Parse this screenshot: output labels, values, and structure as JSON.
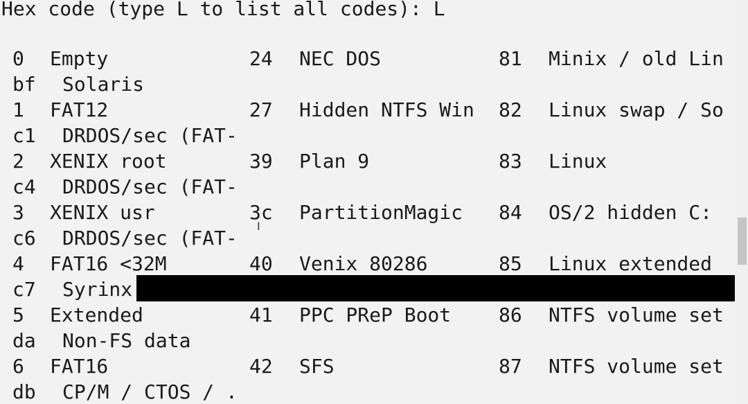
{
  "prompt": "Hex code (type L to list all codes): L",
  "rows": [
    {
      "type": "triple",
      "c1_code": "0",
      "c1_name": "Empty",
      "c2_code": "24",
      "c2_name": "NEC DOS",
      "c3_code": "81",
      "c3_name": "Minix / old Lin"
    },
    {
      "type": "single",
      "code": "bf",
      "name": "Solaris"
    },
    {
      "type": "triple",
      "c1_code": "1",
      "c1_name": "FAT12",
      "c2_code": "27",
      "c2_name": "Hidden NTFS Win",
      "c3_code": "82",
      "c3_name": "Linux swap / So"
    },
    {
      "type": "single",
      "code": "c1",
      "name": "DRDOS/sec (FAT-"
    },
    {
      "type": "triple",
      "c1_code": "2",
      "c1_name": "XENIX root",
      "c2_code": "39",
      "c2_name": "Plan 9",
      "c3_code": "83",
      "c3_name": "Linux"
    },
    {
      "type": "single",
      "code": "c4",
      "name": "DRDOS/sec (FAT-"
    },
    {
      "type": "triple",
      "c1_code": "3",
      "c1_name": "XENIX usr",
      "c2_code": "3c",
      "c2_name": "PartitionMagic",
      "c3_code": "84",
      "c3_name": "OS/2 hidden C:"
    },
    {
      "type": "single",
      "code": "c6",
      "name": "DRDOS/sec (FAT-"
    },
    {
      "type": "triple",
      "c1_code": "4",
      "c1_name": "FAT16 <32M",
      "c2_code": "40",
      "c2_name": "Venix 80286",
      "c3_code": "85",
      "c3_name": "Linux extended"
    },
    {
      "type": "single",
      "code": "c7",
      "name": "Syrinx"
    },
    {
      "type": "triple",
      "c1_code": "5",
      "c1_name": "Extended",
      "c2_code": "41",
      "c2_name": "PPC PReP Boot",
      "c3_code": "86",
      "c3_name": "NTFS volume set"
    },
    {
      "type": "single",
      "code": "da",
      "name": "Non-FS data"
    },
    {
      "type": "triple",
      "c1_code": "6",
      "c1_name": "FAT16",
      "c2_code": "42",
      "c2_name": "SFS",
      "c3_code": "87",
      "c3_name": "NTFS volume set"
    },
    {
      "type": "single",
      "code": "db",
      "name": "CP/M / CTOS / ."
    }
  ],
  "colors": {
    "background": "#f2f2f2",
    "text": "#1a1a1a",
    "redaction": "#000000",
    "scroll_thumb": "#c4c4c4"
  },
  "icons": {
    "cursor": "i-beam-cursor-icon"
  }
}
